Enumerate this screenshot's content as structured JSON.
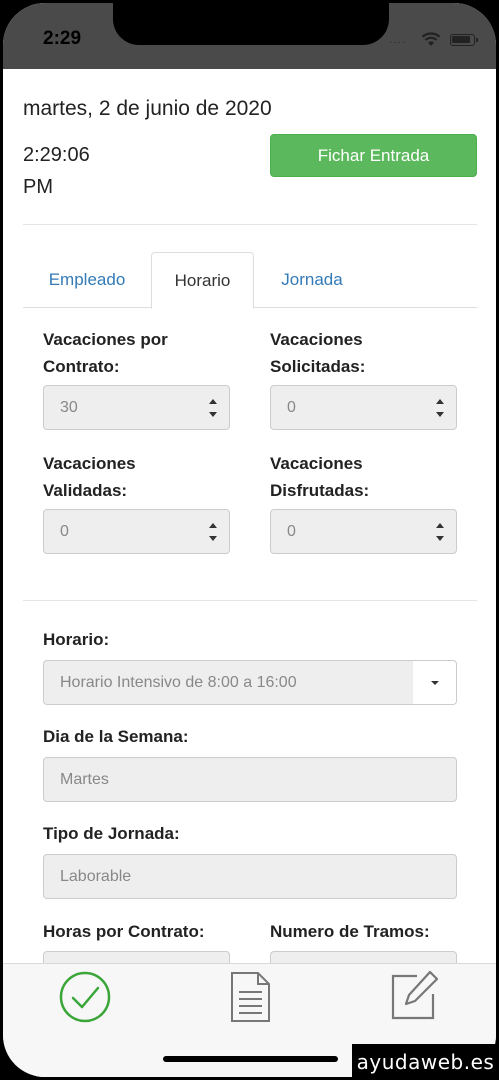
{
  "status_bar": {
    "time": "2:29",
    "dots": "····"
  },
  "header": {
    "date": "martes, 2 de junio de 2020",
    "clock_time": "2:29:06",
    "clock_ampm": "PM",
    "fichar_label": "Fichar Entrada"
  },
  "tabs": [
    {
      "label": "Empleado",
      "active": false
    },
    {
      "label": "Horario",
      "active": true
    },
    {
      "label": "Jornada",
      "active": false
    }
  ],
  "vacaciones": {
    "contrato_label_1": "Vacaciones por",
    "contrato_label_2": "Contrato:",
    "contrato_value": "30",
    "solicitadas_label_1": "Vacaciones",
    "solicitadas_label_2": "Solicitadas:",
    "solicitadas_value": "0",
    "validadas_label_1": "Vacaciones",
    "validadas_label_2": "Validadas:",
    "validadas_value": "0",
    "disfrutadas_label_1": "Vacaciones",
    "disfrutadas_label_2": "Disfrutadas:",
    "disfrutadas_value": "0"
  },
  "horario": {
    "horario_label": "Horario:",
    "horario_value": "Horario Intensivo de 8:00 a 16:00",
    "dia_label": "Dia de la Semana:",
    "dia_value": "Martes",
    "tipo_label": "Tipo de Jornada:",
    "tipo_value": "Laborable",
    "horas_label": "Horas por Contrato:",
    "tramos_label": "Numero de Tramos:"
  },
  "tabbar": {
    "icons": [
      "check-circle-icon",
      "document-icon",
      "edit-icon"
    ],
    "active_color": "#3aa63a"
  },
  "watermark": "ayudaweb.es",
  "colors": {
    "accent_green": "#5cb85c",
    "link_blue": "#337ab7"
  }
}
